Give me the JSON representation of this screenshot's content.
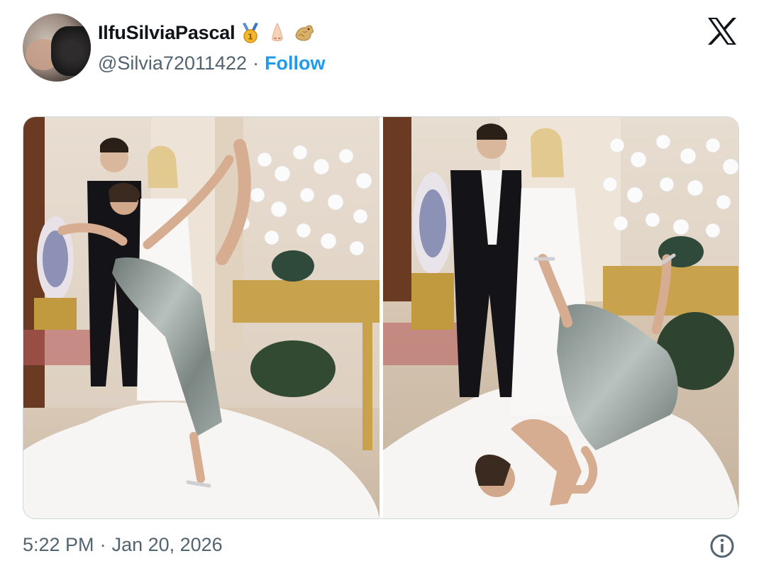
{
  "tweet": {
    "author": {
      "display_name": "IlfuSilviaPascal",
      "handle": "@Silvia72011422",
      "badges": [
        "medal-icon",
        "nose-icon",
        "dragon-icon"
      ],
      "follow_label": "Follow"
    },
    "separator": "·",
    "timestamp": {
      "time": "5:22 PM",
      "date": "Jan 20, 2026"
    },
    "media": [
      {
        "kind": "photo",
        "description": "wedding-photo-left"
      },
      {
        "kind": "photo",
        "description": "wedding-photo-right"
      }
    ]
  },
  "icons": {
    "brand": "x-logo-icon",
    "info": "info-icon"
  },
  "colors": {
    "link": "#1d9bf0",
    "secondary_text": "#536471",
    "primary_text": "#0f1419"
  }
}
